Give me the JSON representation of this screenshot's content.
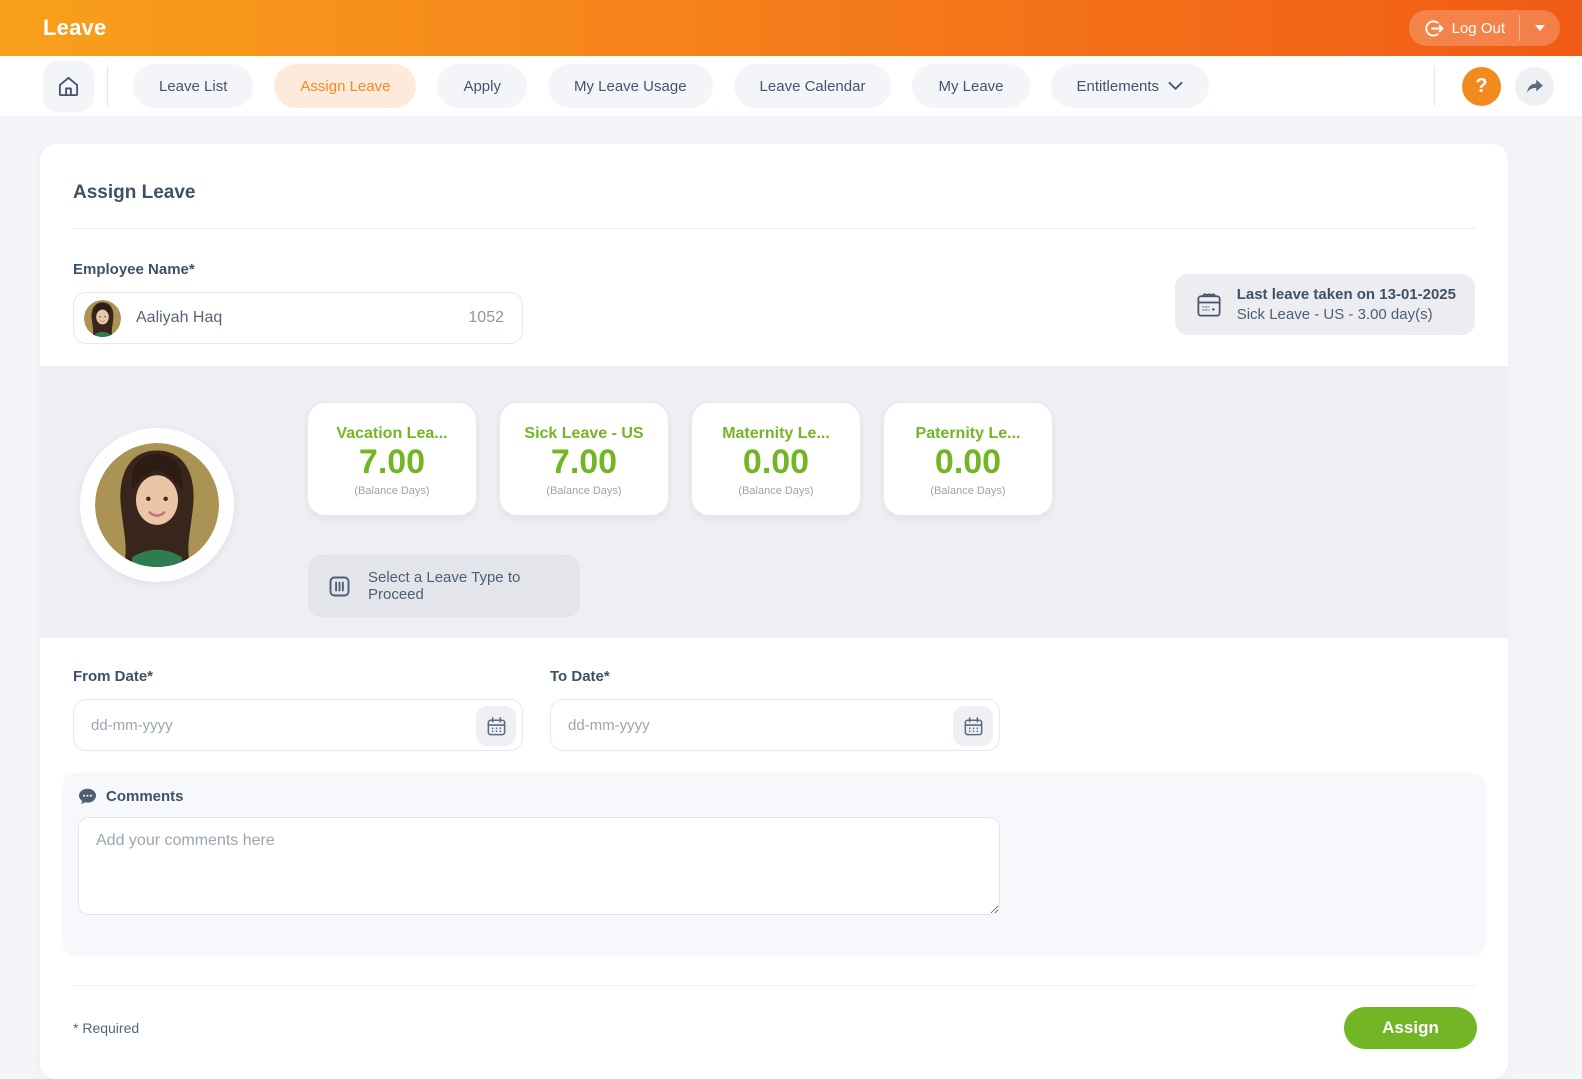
{
  "header": {
    "title": "Leave",
    "logout_label": "Log Out"
  },
  "nav": {
    "tabs": [
      {
        "label": "Leave List"
      },
      {
        "label": "Assign Leave",
        "active": true
      },
      {
        "label": "Apply"
      },
      {
        "label": "My Leave Usage"
      },
      {
        "label": "Leave Calendar"
      },
      {
        "label": "My Leave"
      },
      {
        "label": "Entitlements",
        "has_dropdown": true
      }
    ],
    "help_label": "?"
  },
  "form": {
    "title": "Assign Leave",
    "employee_label": "Employee Name*",
    "employee": {
      "name": "Aaliyah Haq",
      "id": "1052"
    },
    "last_leave": {
      "line1": "Last leave taken on 13-01-2025",
      "line2": "Sick Leave - US - 3.00 day(s)"
    },
    "balances": [
      {
        "type": "Vacation Lea...",
        "value": "7.00",
        "unit": "(Balance Days)"
      },
      {
        "type": "Sick Leave - US",
        "value": "7.00",
        "unit": "(Balance Days)"
      },
      {
        "type": "Maternity Le...",
        "value": "0.00",
        "unit": "(Balance Days)"
      },
      {
        "type": "Paternity Le...",
        "value": "0.00",
        "unit": "(Balance Days)"
      }
    ],
    "select_leave_hint": "Select a Leave Type to Proceed",
    "from_date_label": "From Date*",
    "to_date_label": "To Date*",
    "date_placeholder": "dd-mm-yyyy",
    "comments_label": "Comments",
    "comments_placeholder": "Add your comments here",
    "required_note": "* Required",
    "assign_label": "Assign"
  },
  "colors": {
    "accent_orange": "#f28b1f",
    "header_gradient_start": "#f9a01b",
    "header_gradient_end": "#f15b16",
    "success_green": "#72b626",
    "slate_text": "#3d5269"
  }
}
